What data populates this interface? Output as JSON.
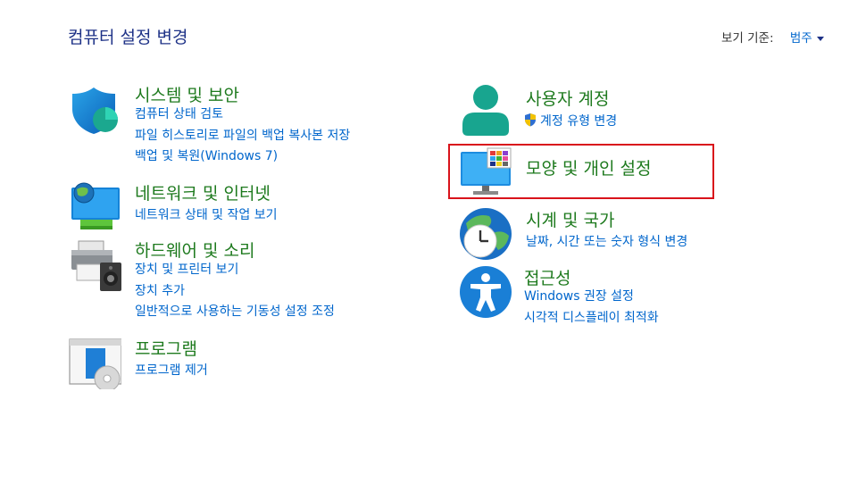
{
  "header": {
    "title": "컴퓨터 설정 변경",
    "view_by_label": "보기 기준:",
    "view_by_value": "범주"
  },
  "left_categories": [
    {
      "title": "시스템 및 보안",
      "icon": "shield-icon",
      "links": [
        "컴퓨터 상태 검토",
        "파일 히스토리로 파일의 백업 복사본 저장",
        "백업 및 복원(Windows 7)"
      ]
    },
    {
      "title": "네트워크 및 인터넷",
      "icon": "network-globe-icon",
      "links": [
        "네트워크 상태 및 작업 보기"
      ]
    },
    {
      "title": "하드웨어 및 소리",
      "icon": "printer-speaker-icon",
      "links": [
        "장치 및 프린터 보기",
        "장치 추가",
        "일반적으로 사용하는 기동성 설정 조정"
      ]
    },
    {
      "title": "프로그램",
      "icon": "program-disc-icon",
      "links": [
        "프로그램 제거"
      ]
    }
  ],
  "right_categories": [
    {
      "title": "사용자 계정",
      "icon": "user-icon",
      "links": [
        "계정 유형 변경"
      ]
    },
    {
      "title": "모양 및 개인 설정",
      "icon": "monitor-palette-icon",
      "links": []
    },
    {
      "title": "시계 및 국가",
      "icon": "clock-globe-icon",
      "links": [
        "날짜, 시간 또는 숫자 형식 변경"
      ]
    },
    {
      "title": "접근성",
      "icon": "accessibility-icon",
      "links": [
        "Windows 권장 설정",
        "시각적 디스플레이 최적화"
      ]
    }
  ],
  "colors": {
    "title_blue": "#1e3287",
    "category_green": "#1e7a1e",
    "link_blue": "#0066cc",
    "highlight_red": "#d9131b"
  }
}
